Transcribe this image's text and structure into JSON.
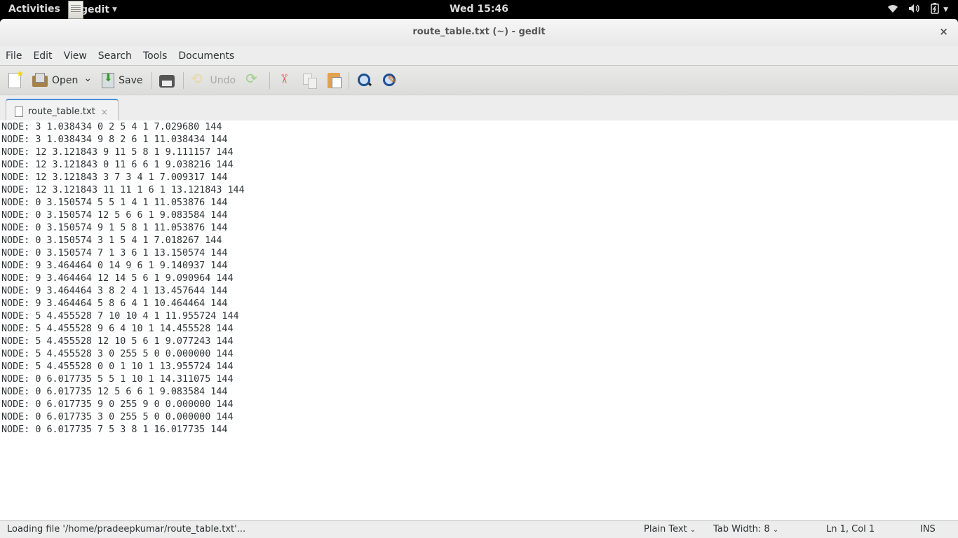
{
  "topbar": {
    "activities": "Activities",
    "app_name": "gedit",
    "clock": "Wed 15:46",
    "tray_icons": [
      "wifi-icon",
      "volume-icon",
      "battery-icon"
    ]
  },
  "window": {
    "title": "route_table.txt (~) - gedit",
    "close_glyph": "×"
  },
  "menubar": {
    "items": [
      "File",
      "Edit",
      "View",
      "Search",
      "Tools",
      "Documents"
    ]
  },
  "toolbar": {
    "open_label": "Open",
    "save_label": "Save",
    "undo_label": "Undo",
    "dropdown_glyph": "⌄"
  },
  "tabs": [
    {
      "label": "route_table.txt",
      "close_glyph": "×",
      "active": true
    }
  ],
  "editor": {
    "lines": [
      "NODE: 3 1.038434 0 2 5 4 1 7.029680 144",
      "NODE: 3 1.038434 9 8 2 6 1 11.038434 144",
      "NODE: 12 3.121843 9 11 5 8 1 9.111157 144",
      "NODE: 12 3.121843 0 11 6 6 1 9.038216 144",
      "NODE: 12 3.121843 3 7 3 4 1 7.009317 144",
      "NODE: 12 3.121843 11 11 1 6 1 13.121843 144",
      "NODE: 0 3.150574 5 5 1 4 1 11.053876 144",
      "NODE: 0 3.150574 12 5 6 6 1 9.083584 144",
      "NODE: 0 3.150574 9 1 5 8 1 11.053876 144",
      "NODE: 0 3.150574 3 1 5 4 1 7.018267 144",
      "NODE: 0 3.150574 7 1 3 6 1 13.150574 144",
      "NODE: 9 3.464464 0 14 9 6 1 9.140937 144",
      "NODE: 9 3.464464 12 14 5 6 1 9.090964 144",
      "NODE: 9 3.464464 3 8 2 4 1 13.457644 144",
      "NODE: 9 3.464464 5 8 6 4 1 10.464464 144",
      "NODE: 5 4.455528 7 10 10 4 1 11.955724 144",
      "NODE: 5 4.455528 9 6 4 10 1 14.455528 144",
      "NODE: 5 4.455528 12 10 5 6 1 9.077243 144",
      "NODE: 5 4.455528 3 0 255 5 0 0.000000 144",
      "NODE: 5 4.455528 0 0 1 10 1 13.955724 144",
      "NODE: 0 6.017735 5 5 1 10 1 14.311075 144",
      "NODE: 0 6.017735 12 5 6 6 1 9.083584 144",
      "NODE: 0 6.017735 9 0 255 9 0 0.000000 144",
      "NODE: 0 6.017735 3 0 255 5 0 0.000000 144",
      "NODE: 0 6.017735 7 5 3 8 1 16.017735 144"
    ]
  },
  "statusbar": {
    "message": "Loading file '/home/pradeepkumar/route_table.txt'...",
    "language": "Plain Text",
    "tab_width": "Tab Width: 8",
    "cursor_position": "Ln 1, Col 1",
    "mode": "INS",
    "chevron": "⌄"
  }
}
